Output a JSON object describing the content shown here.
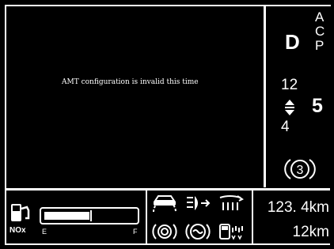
{
  "message": "AMT configuration is invalid this time",
  "transmission": {
    "gear_mode": "D",
    "modes": [
      "A",
      "C",
      "P"
    ],
    "gear_range_top": "12",
    "gear_range_bottom": "4",
    "current_gear": "5",
    "start_gear_circle": "3"
  },
  "fuel": {
    "label": "NOx",
    "empty_label": "E",
    "full_label": "F",
    "level_fraction": 0.5
  },
  "indicators": [
    "driver-assist-warning-icon",
    "headlight-leveling-icon",
    "rear-fog-defrost-icon",
    "brake-warning-icon",
    "tire-pressure-icon",
    "fuel-filter-icon"
  ],
  "odometer": {
    "total": "123. 4km",
    "trip": "12km"
  }
}
